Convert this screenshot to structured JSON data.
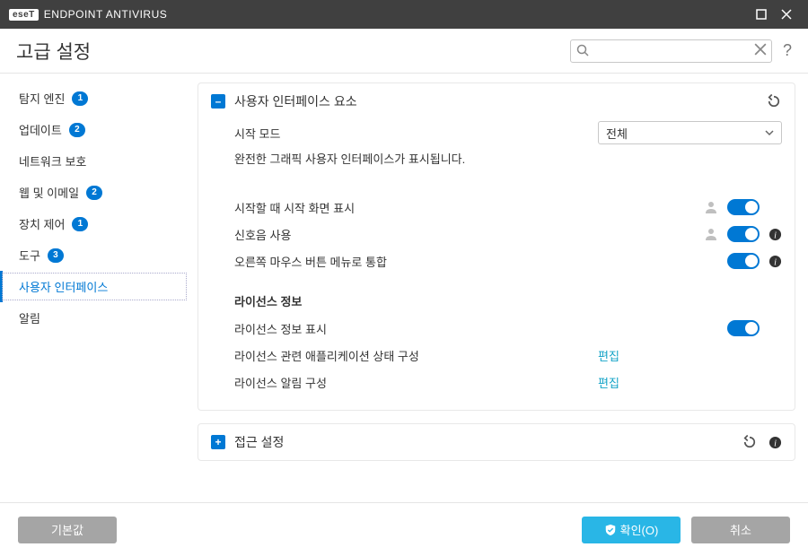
{
  "titlebar": {
    "brand_box": "eseT",
    "brand_text": "ENDPOINT ANTIVIRUS"
  },
  "header": {
    "title": "고급 설정",
    "search_placeholder": ""
  },
  "sidebar": {
    "items": [
      {
        "label": "탐지 엔진",
        "badge": "1"
      },
      {
        "label": "업데이트",
        "badge": "2"
      },
      {
        "label": "네트워크 보호",
        "badge": ""
      },
      {
        "label": "웹 및 이메일",
        "badge": "2"
      },
      {
        "label": "장치 제어",
        "badge": "1"
      },
      {
        "label": "도구",
        "badge": "3"
      },
      {
        "label": "사용자 인터페이스",
        "badge": ""
      },
      {
        "label": "알림",
        "badge": ""
      }
    ]
  },
  "panel_ui": {
    "collapse_glyph": "–",
    "title": "사용자 인터페이스 요소",
    "start_mode_label": "시작 모드",
    "start_mode_value": "전체",
    "desc": "완전한 그래픽 사용자 인터페이스가 표시됩니다.",
    "opt_splash": "시작할 때 시작 화면 표시",
    "opt_sound": "신호음 사용",
    "opt_context": "오른쪽 마우스 버튼 메뉴로 통합",
    "license_heading": "라이선스 정보",
    "opt_license_show": "라이선스 정보 표시",
    "opt_license_appstate": "라이선스 관련 애플리케이션 상태 구성",
    "opt_license_alert": "라이선스 알림 구성",
    "edit_link": "편집"
  },
  "panel_access": {
    "expand_glyph": "+",
    "title": "접근 설정"
  },
  "footer": {
    "default": "기본값",
    "ok": "확인(O)",
    "cancel": "취소"
  }
}
